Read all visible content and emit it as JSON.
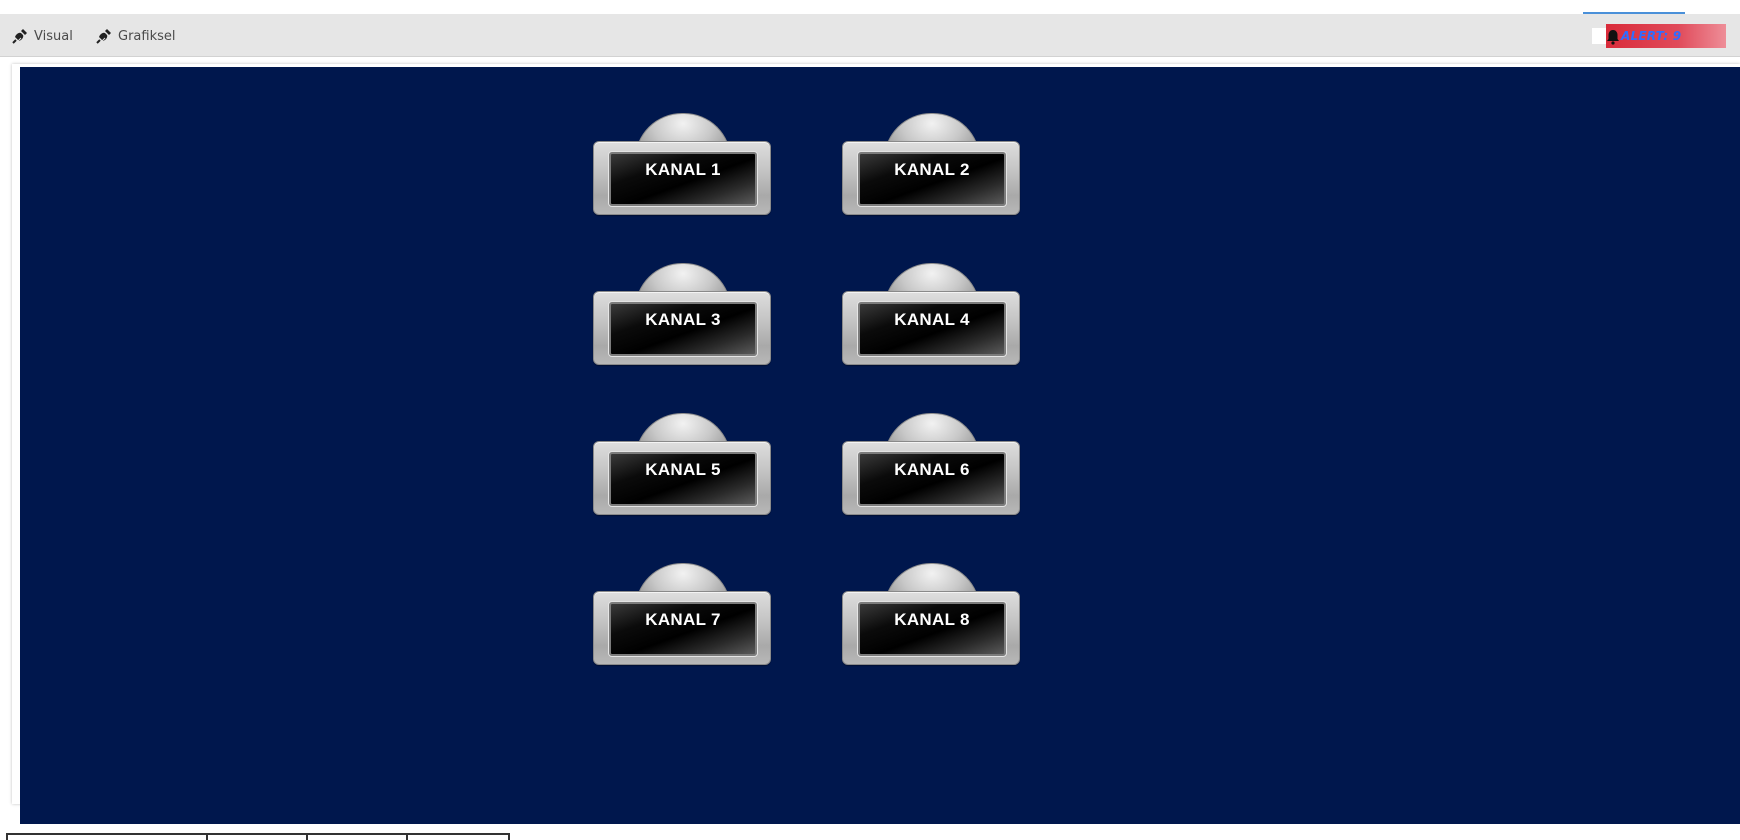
{
  "toolbar": {
    "visual_label": "Visual",
    "grafiksel_label": "Grafiksel",
    "alert_label": "ALERT: 9"
  },
  "colors": {
    "panel_background": "#00174d",
    "alert_background": "#d92b3a",
    "alert_text": "#2f6dff"
  },
  "icons": {
    "visual": "plug-icon",
    "grafiksel": "plug-icon",
    "alert": "bell-icon"
  },
  "channels": [
    {
      "label": "KANAL 1"
    },
    {
      "label": "KANAL 2"
    },
    {
      "label": "KANAL 3"
    },
    {
      "label": "KANAL 4"
    },
    {
      "label": "KANAL 5"
    },
    {
      "label": "KANAL 6"
    },
    {
      "label": "KANAL 7"
    },
    {
      "label": "KANAL 8"
    }
  ]
}
